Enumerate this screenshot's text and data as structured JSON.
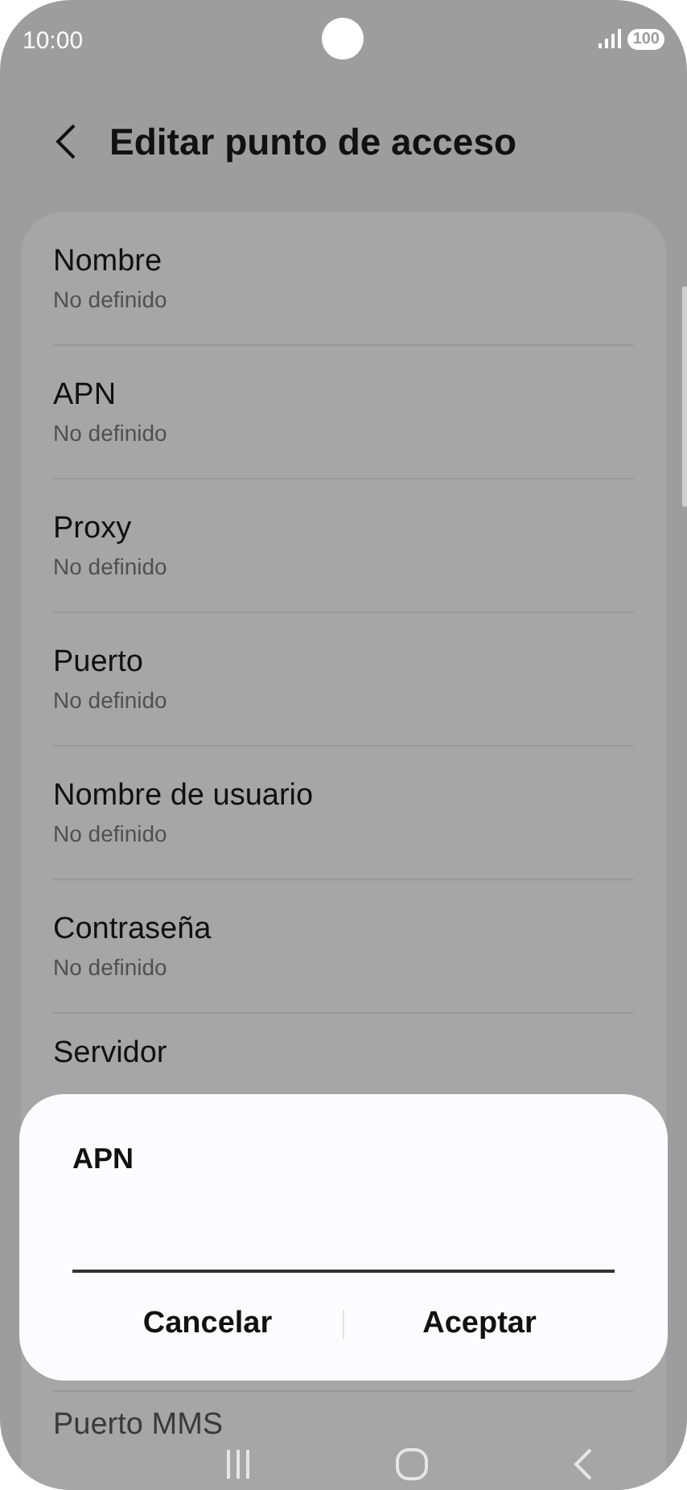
{
  "status_bar": {
    "time": "10:00",
    "battery": "100"
  },
  "header": {
    "title": "Editar punto de acceso"
  },
  "fields": [
    {
      "label": "Nombre",
      "value": "No definido"
    },
    {
      "label": "APN",
      "value": "No definido"
    },
    {
      "label": "Proxy",
      "value": "No definido"
    },
    {
      "label": "Puerto",
      "value": "No definido"
    },
    {
      "label": "Nombre de usuario",
      "value": "No definido"
    },
    {
      "label": "Contraseña",
      "value": "No definido"
    },
    {
      "label": "Servidor"
    },
    {
      "label": "Puerto MMS"
    }
  ],
  "dialog": {
    "title": "APN",
    "buttons": [
      "Cancelar",
      "Aceptar"
    ]
  }
}
